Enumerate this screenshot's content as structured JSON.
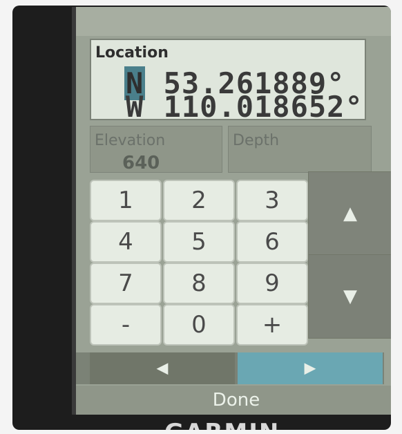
{
  "location": {
    "label": "Location",
    "lat_hemisphere": "N",
    "lat_value": "53.261889°",
    "lon_hemisphere": "W",
    "lon_value": "110.018652°"
  },
  "fields": {
    "elevation_label": "Elevation",
    "elevation_value": "640",
    "depth_label": "Depth"
  },
  "keypad": {
    "keys": [
      "1",
      "2",
      "3",
      "4",
      "5",
      "6",
      "7",
      "8",
      "9",
      "-",
      "0",
      "+"
    ]
  },
  "navigation": {
    "up_glyph": "▲",
    "down_glyph": "▼",
    "left_glyph": "◀",
    "right_glyph": "▶"
  },
  "footer": {
    "done_label": "Done",
    "brand": "GARMIN"
  },
  "colors": {
    "screen_bg": "#9aa295",
    "location_box": "#dfe6dc",
    "key_bg": "#e6ece3",
    "selected_nav": "#6aa7b3"
  }
}
